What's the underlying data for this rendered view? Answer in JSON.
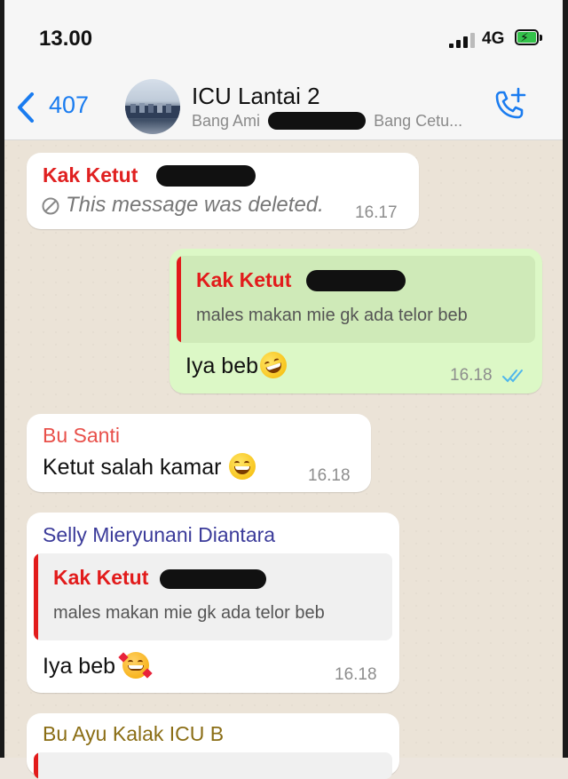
{
  "status_bar": {
    "time": "13.00",
    "network": "4G",
    "battery_icon": "battery-charging-icon",
    "signal_icon": "signal-icon"
  },
  "header": {
    "back_count": "407",
    "title": "ICU Lantai 2",
    "members_start": "Bang Ami",
    "members_end": "Bang Cetu...",
    "call_icon": "add-call-icon"
  },
  "colors": {
    "accent": "#1a7cf0",
    "outgoing_bubble": "#dcf8c6",
    "incoming_bubble": "#ffffff",
    "quote_red": "#e21b1b",
    "read_ticks": "#4fb6ec"
  },
  "messages": [
    {
      "direction": "in",
      "sender": "Kak Ketut",
      "sender_color": "#e02020",
      "deleted_text": "This message was deleted.",
      "time": "16.17"
    },
    {
      "direction": "out",
      "quote_sender": "Kak Ketut",
      "quote_text": "males makan mie gk ada telor beb",
      "text": "Iya beb",
      "emoji": "rolling-on-floor-laughing",
      "time": "16.18",
      "status": "read"
    },
    {
      "direction": "in",
      "sender": "Bu Santi",
      "sender_color": "#e8504a",
      "text": "Ketut salah kamar",
      "emoji": "grinning-face",
      "time": "16.18"
    },
    {
      "direction": "in",
      "sender": "Selly Mieryunani Diantara",
      "sender_color": "#3b3b9a",
      "quote_sender": "Kak Ketut",
      "quote_text": "males makan mie gk ada telor beb",
      "text": "Iya beb",
      "emoji": "smiling-face-with-hearts",
      "time": "16.18"
    },
    {
      "direction": "in",
      "sender": "Bu Ayu Kalak ICU B",
      "sender_color": "#8a6d14"
    }
  ]
}
